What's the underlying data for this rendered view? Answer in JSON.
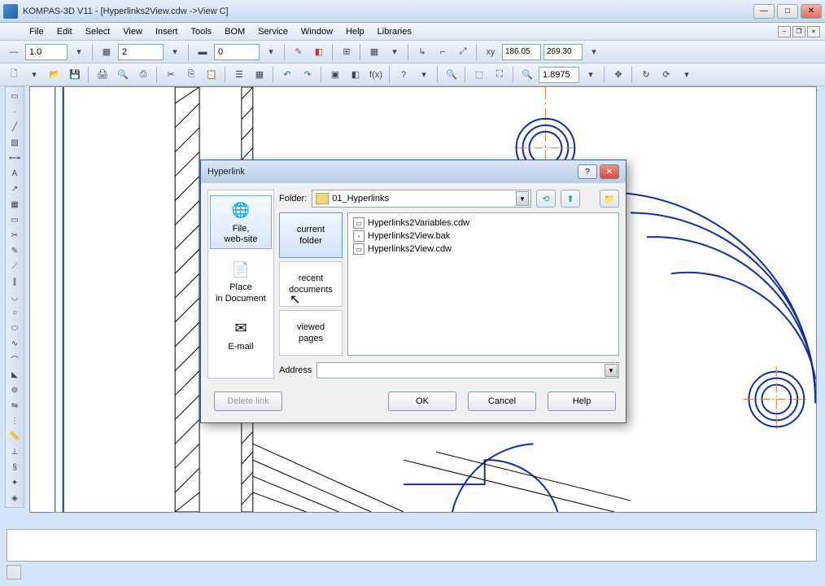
{
  "app": {
    "title": "KOMPAS-3D V11 - [Hyperlinks2View.cdw ->View C]"
  },
  "menu": {
    "file": "File",
    "edit": "Edit",
    "select": "Select",
    "view": "View",
    "insert": "Insert",
    "tools": "Tools",
    "bom": "BOM",
    "service": "Service",
    "window": "Window",
    "help": "Help",
    "libraries": "Libraries"
  },
  "toolbar1": {
    "val1": "1.0",
    "val2": "2",
    "val3": "0",
    "coord_x": "186.05",
    "coord_y": "269.30"
  },
  "toolbar2": {
    "zoom": "1.8975"
  },
  "dialog": {
    "title": "Hyperlink",
    "link_types": {
      "file_web": "File,\nweb-site",
      "place_doc": "Place\nin Document",
      "email": "E-mail"
    },
    "folder_label": "Folder:",
    "folder_value": "01_Hyperlinks",
    "browse_tabs": {
      "current": "current\nfolder",
      "recent": "recent\ndocuments",
      "viewed": "viewed\npages"
    },
    "files": [
      "Hyperlinks2Variables.cdw",
      "Hyperlinks2View.bak",
      "Hyperlinks2View.cdw"
    ],
    "address_label": "Address",
    "buttons": {
      "delete": "Delete link",
      "ok": "OK",
      "cancel": "Cancel",
      "help": "Help"
    }
  }
}
